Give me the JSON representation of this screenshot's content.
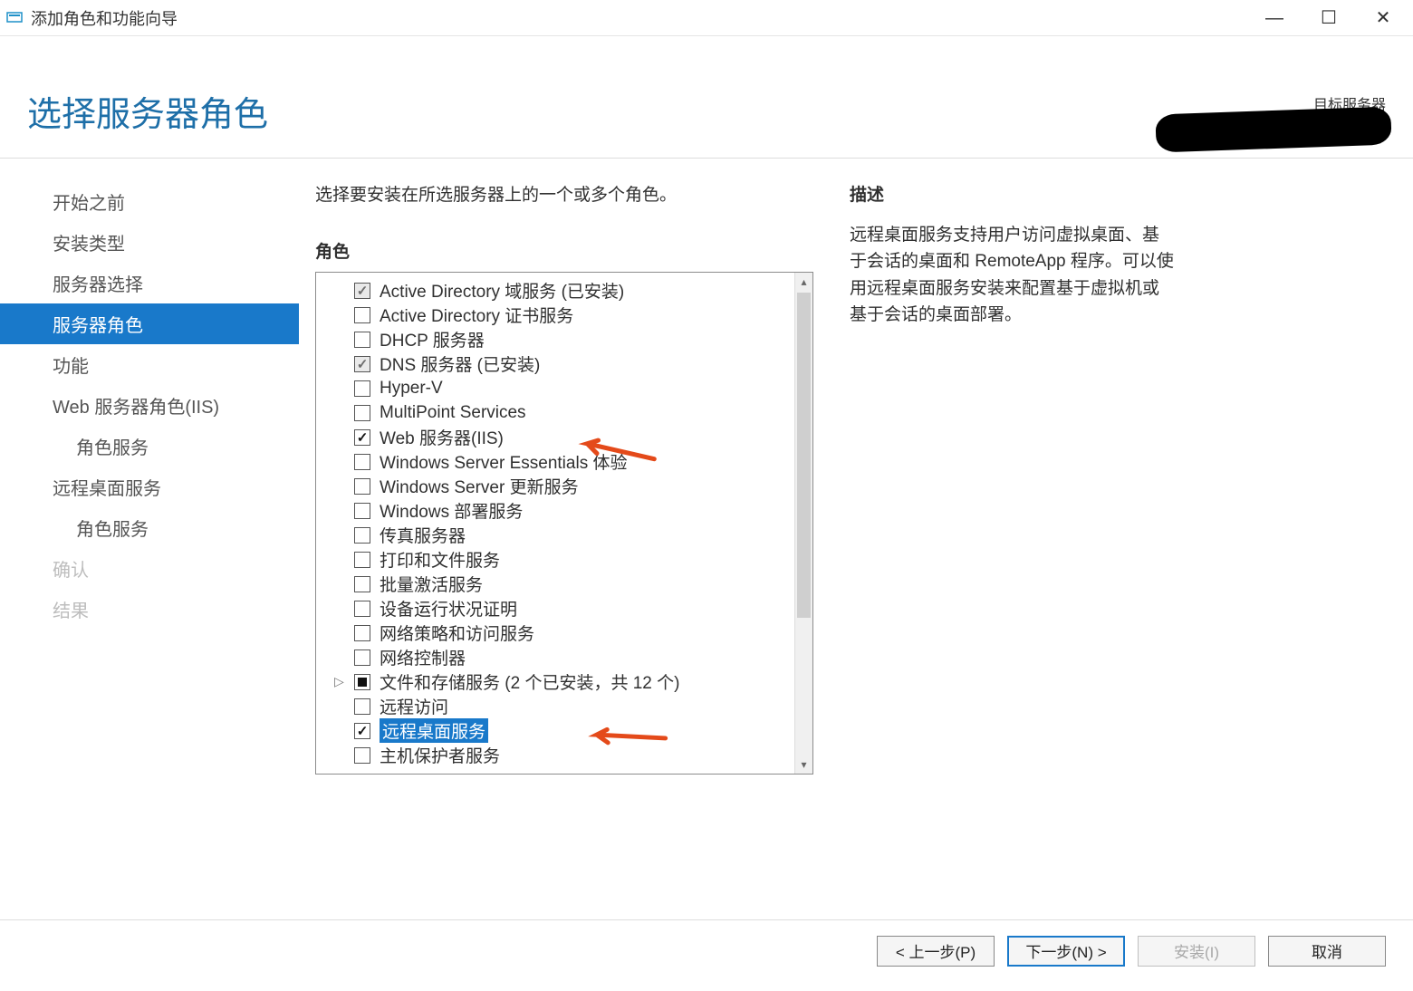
{
  "window": {
    "title": "添加角色和功能向导"
  },
  "header": {
    "page_title": "选择服务器角色",
    "target_label": "目标服务器"
  },
  "sidebar": {
    "items": [
      {
        "label": "开始之前",
        "key": "before"
      },
      {
        "label": "安装类型",
        "key": "install-type"
      },
      {
        "label": "服务器选择",
        "key": "server-select"
      },
      {
        "label": "服务器角色",
        "key": "server-roles",
        "selected": true
      },
      {
        "label": "功能",
        "key": "features"
      },
      {
        "label": "Web 服务器角色(IIS)",
        "key": "iis"
      },
      {
        "label": "角色服务",
        "key": "iis-role-services",
        "sub": true
      },
      {
        "label": "远程桌面服务",
        "key": "rds"
      },
      {
        "label": "角色服务",
        "key": "rds-role-services",
        "sub": true
      },
      {
        "label": "确认",
        "key": "confirm",
        "disabled": true
      },
      {
        "label": "结果",
        "key": "result",
        "disabled": true
      }
    ]
  },
  "main": {
    "instruction": "选择要安装在所选服务器上的一个或多个角色。",
    "roles_label": "角色",
    "roles": [
      {
        "label": "Active Directory 域服务 (已安装)",
        "state": "installed"
      },
      {
        "label": "Active Directory 证书服务",
        "state": "unchecked"
      },
      {
        "label": "DHCP 服务器",
        "state": "unchecked"
      },
      {
        "label": "DNS 服务器 (已安装)",
        "state": "installed"
      },
      {
        "label": "Hyper-V",
        "state": "unchecked"
      },
      {
        "label": "MultiPoint Services",
        "state": "unchecked"
      },
      {
        "label": "Web 服务器(IIS)",
        "state": "checked",
        "annotated": true
      },
      {
        "label": "Windows Server Essentials 体验",
        "state": "unchecked"
      },
      {
        "label": "Windows Server 更新服务",
        "state": "unchecked"
      },
      {
        "label": "Windows 部署服务",
        "state": "unchecked"
      },
      {
        "label": "传真服务器",
        "state": "unchecked"
      },
      {
        "label": "打印和文件服务",
        "state": "unchecked"
      },
      {
        "label": "批量激活服务",
        "state": "unchecked"
      },
      {
        "label": "设备运行状况证明",
        "state": "unchecked"
      },
      {
        "label": "网络策略和访问服务",
        "state": "unchecked"
      },
      {
        "label": "网络控制器",
        "state": "unchecked"
      },
      {
        "label": "文件和存储服务 (2 个已安装，共 12 个)",
        "state": "partial",
        "expandable": true
      },
      {
        "label": "远程访问",
        "state": "unchecked"
      },
      {
        "label": "远程桌面服务",
        "state": "checked",
        "selected": true,
        "annotated": true
      },
      {
        "label": "主机保护者服务",
        "state": "unchecked"
      }
    ],
    "desc_label": "描述",
    "desc_text": "远程桌面服务支持用户访问虚拟桌面、基于会话的桌面和 RemoteApp 程序。可以使用远程桌面服务安装来配置基于虚拟机或基于会话的桌面部署。"
  },
  "footer": {
    "prev": "< 上一步(P)",
    "next": "下一步(N) >",
    "install": "安装(I)",
    "cancel": "取消"
  }
}
